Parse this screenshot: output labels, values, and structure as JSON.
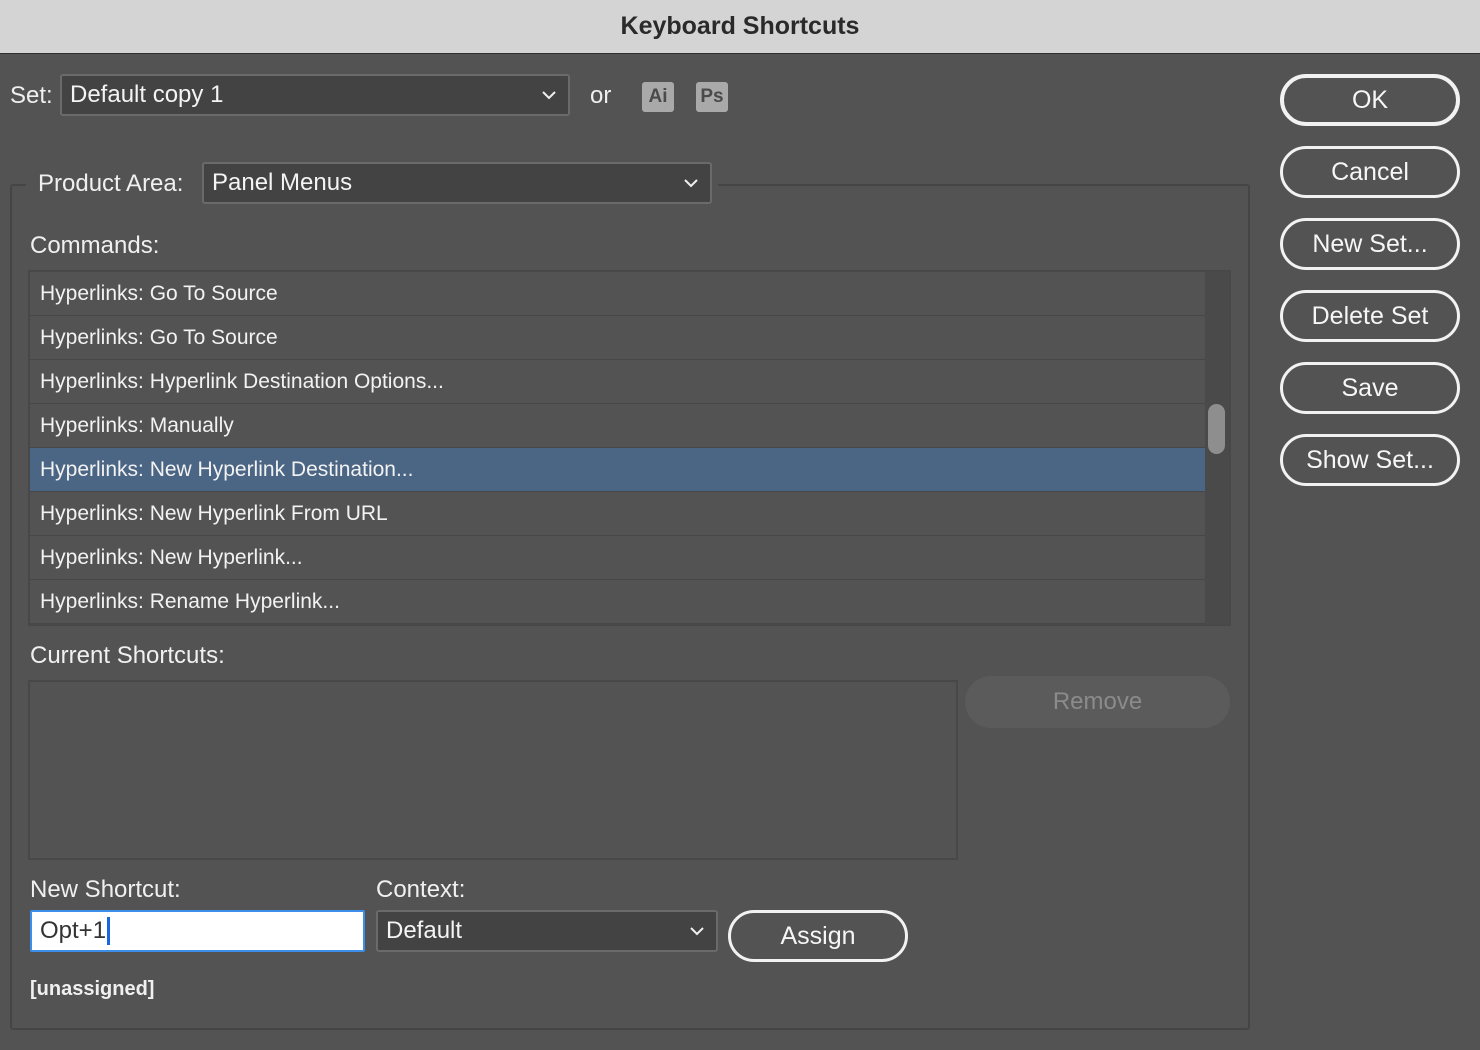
{
  "window": {
    "title": "Keyboard Shortcuts"
  },
  "set": {
    "label": "Set:",
    "value": "Default copy 1",
    "or_label": "or",
    "app_badges": [
      "Ai",
      "Ps"
    ]
  },
  "product_area": {
    "label": "Product Area:",
    "value": "Panel Menus"
  },
  "commands": {
    "label": "Commands:",
    "items": [
      "Hyperlinks: Go To Source",
      "Hyperlinks: Go To Source",
      "Hyperlinks: Hyperlink Destination Options...",
      "Hyperlinks: Manually",
      "Hyperlinks: New Hyperlink Destination...",
      "Hyperlinks: New Hyperlink From URL",
      "Hyperlinks: New Hyperlink...",
      "Hyperlinks: Rename Hyperlink..."
    ],
    "selected_index": 4
  },
  "current_shortcuts": {
    "label": "Current Shortcuts:",
    "remove_label": "Remove"
  },
  "new_shortcut": {
    "label": "New Shortcut:",
    "value": "Opt+1"
  },
  "context": {
    "label": "Context:",
    "value": "Default"
  },
  "assign_label": "Assign",
  "status_text": "[unassigned]",
  "side_buttons": {
    "ok": "OK",
    "cancel": "Cancel",
    "new_set": "New Set...",
    "delete_set": "Delete Set",
    "save": "Save",
    "show_set": "Show Set..."
  },
  "colors": {
    "selection": "#4b6584",
    "background": "#535353",
    "focus_ring": "#3d8ee8"
  }
}
